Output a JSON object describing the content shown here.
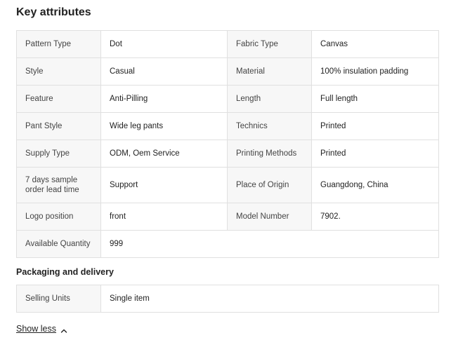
{
  "key_attributes": {
    "title": "Key attributes",
    "rows": [
      [
        {
          "k": "Pattern Type",
          "v": "Dot"
        },
        {
          "k": "Fabric Type",
          "v": "Canvas"
        }
      ],
      [
        {
          "k": "Style",
          "v": "Casual"
        },
        {
          "k": "Material",
          "v": "100% insulation padding"
        }
      ],
      [
        {
          "k": "Feature",
          "v": "Anti-Pilling"
        },
        {
          "k": "Length",
          "v": "Full length"
        }
      ],
      [
        {
          "k": "Pant Style",
          "v": "Wide leg pants"
        },
        {
          "k": "Technics",
          "v": "Printed"
        }
      ],
      [
        {
          "k": "Supply Type",
          "v": "ODM, Oem Service"
        },
        {
          "k": "Printing Methods",
          "v": "Printed"
        }
      ],
      [
        {
          "k": "7 days sample order lead time",
          "v": "Support"
        },
        {
          "k": "Place of Origin",
          "v": "Guangdong, China"
        }
      ],
      [
        {
          "k": "Logo position",
          "v": "front"
        },
        {
          "k": "Model Number",
          "v": "7902."
        }
      ],
      [
        {
          "k": "Available Quantity",
          "v": "999"
        }
      ]
    ]
  },
  "packaging": {
    "title": "Packaging and delivery",
    "rows": [
      {
        "k": "Selling Units",
        "v": "Single item"
      }
    ]
  },
  "toggle": {
    "label": "Show less",
    "icon": "chevron-up-icon"
  },
  "colors": {
    "key_cell_bg": "#f7f7f7",
    "border": "#e0e0e0",
    "text": "#222222"
  }
}
